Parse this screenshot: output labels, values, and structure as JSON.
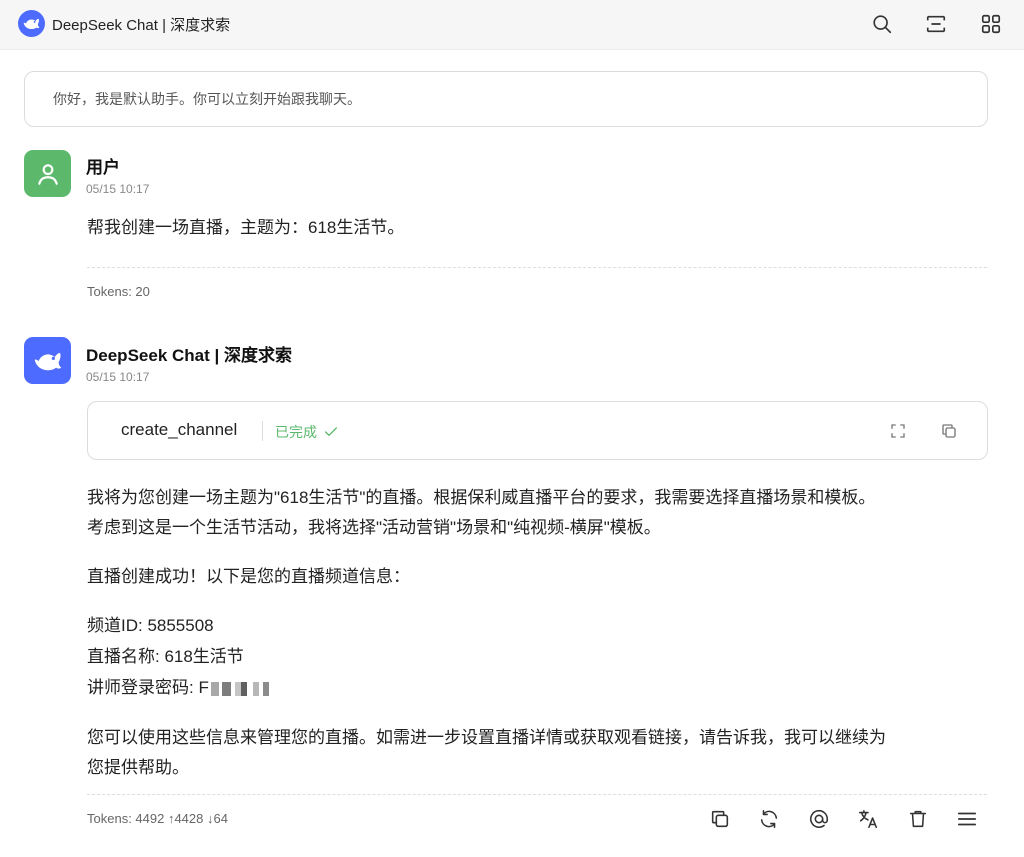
{
  "header": {
    "title": "DeepSeek Chat | 深度求索",
    "icons": [
      "search-icon",
      "scan-icon",
      "grid-icon"
    ]
  },
  "welcome": {
    "text": "你好，我是默认助手。你可以立刻开始跟我聊天。"
  },
  "messages": [
    {
      "role": "user",
      "name": "用户",
      "time": "05/15 10:17",
      "text": "帮我创建一场直播，主题为：618生活节。",
      "tokens": "Tokens: 20"
    },
    {
      "role": "assistant",
      "name": "DeepSeek Chat | 深度求索",
      "time": "05/15 10:17",
      "tool": {
        "name": "create_channel",
        "status": "已完成"
      },
      "paragraphs": [
        "我将为您创建一场主题为\"618生活节\"的直播。根据保利威直播平台的要求，我需要选择直播场景和模板。",
        "考虑到这是一个生活节活动，我将选择\"活动营销\"场景和\"纯视频-横屏\"模板。",
        "直播创建成功！以下是您的直播频道信息：",
        "频道ID: 5855508",
        "直播名称: 618生活节",
        "讲师登录密码: F",
        "您可以使用这些信息来管理您的直播。如需进一步设置直播详情或获取观看链接，请告诉我，我可以继续为",
        "您提供帮助。"
      ],
      "tokens": "Tokens: 4492 ↑4428 ↓64"
    }
  ],
  "actions": [
    "copy-icon",
    "regenerate-icon",
    "mention-icon",
    "translate-icon",
    "delete-icon",
    "menu-icon"
  ],
  "colors": {
    "accent": "#4d6bfe",
    "user_avatar": "#5cb96c",
    "success": "#5cb96c"
  }
}
